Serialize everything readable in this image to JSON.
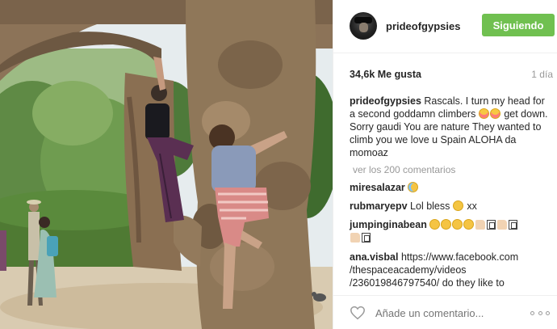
{
  "post": {
    "username": "prideofgypsies",
    "follow_label": "Siguiendo",
    "likes": "34,6k Me gusta",
    "time": "1 día"
  },
  "caption": {
    "user": "prideofgypsies",
    "text": "Rascals. I turn my head for a second goddamn climbers",
    "text2": "get down. Sorry gaudi You are nature They wanted to climb you we love u Spain ALOHA da momoaz"
  },
  "more_comments": "ver los 200 comentarios",
  "comments": [
    {
      "user": "miresalazar",
      "text": ""
    },
    {
      "user": "rubmaryepv",
      "text": "Lol bless",
      "text_after": "xx"
    },
    {
      "user": "jumpinginabean",
      "text": ""
    },
    {
      "user": "ana.visbal",
      "text": "https://www.facebook.com /thespaceacademy/videos /236019846797540/ do they like to"
    }
  ],
  "footer": {
    "add_comment_placeholder": "Añade un comentario..."
  },
  "colors": {
    "follow_button": "#70c050",
    "muted_text": "#999999"
  },
  "icons": [
    "avatar",
    "heart-icon",
    "more-options-icon",
    "emoji",
    "thumbs-up-emoji",
    "missing-glyph"
  ]
}
